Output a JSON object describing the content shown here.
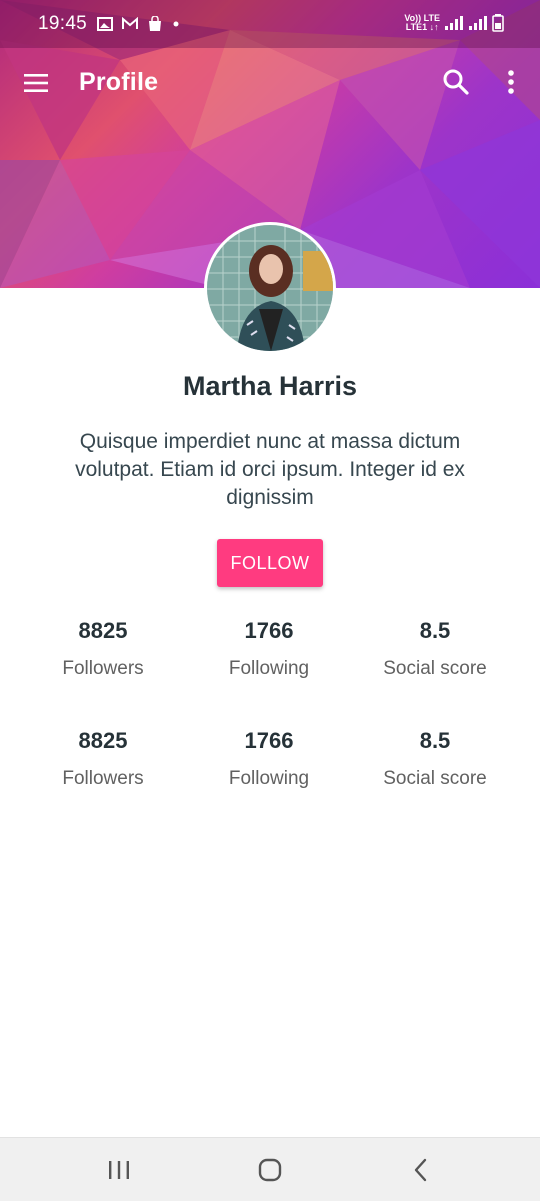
{
  "status_bar": {
    "time": "19:45",
    "net_line1": "Vo)) LTE",
    "net_line2": "LTE1 ↓↑"
  },
  "app_bar": {
    "title": "Profile",
    "icons": [
      "menu-icon",
      "search-icon",
      "more-vert-icon"
    ]
  },
  "profile": {
    "name": "Martha Harris",
    "bio": "Quisque imperdiet nunc at massa dictum volutpat. Etiam id orci ipsum. Integer id ex dignissim",
    "follow_label": "FOLLOW"
  },
  "stats_rows": [
    [
      {
        "value": "8825",
        "label": "Followers"
      },
      {
        "value": "1766",
        "label": "Following"
      },
      {
        "value": "8.5",
        "label": "Social score"
      }
    ],
    [
      {
        "value": "8825",
        "label": "Followers"
      },
      {
        "value": "1766",
        "label": "Following"
      },
      {
        "value": "8.5",
        "label": "Social score"
      }
    ]
  ],
  "colors": {
    "accent": "#ff3b80",
    "banner_start": "#b0287d",
    "banner_end": "#8b2fd8"
  },
  "nav_bar": {
    "icons": [
      "recent-apps-icon",
      "home-icon",
      "back-icon"
    ]
  }
}
